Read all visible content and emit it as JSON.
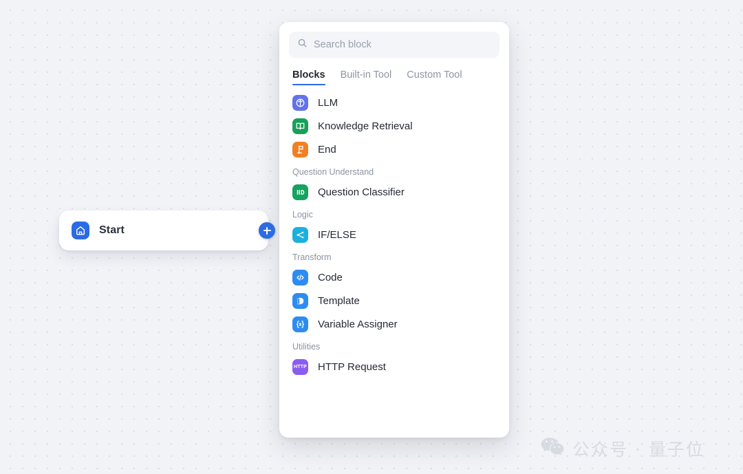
{
  "canvas": {
    "start_node": {
      "icon": "home-icon",
      "label": "Start",
      "add_handle": "plus-icon",
      "accent_color": "#2b6be4"
    }
  },
  "panel": {
    "search": {
      "icon": "search-icon",
      "value": "",
      "placeholder": "Search block"
    },
    "tabs": [
      {
        "label": "Blocks",
        "active": true
      },
      {
        "label": "Built-in Tool",
        "active": false
      },
      {
        "label": "Custom Tool",
        "active": false
      }
    ],
    "active_tab_color": "#2b6be4",
    "groups": [
      {
        "label": "",
        "items": [
          {
            "label": "LLM",
            "icon": "llm-icon",
            "color": "#6472ea"
          },
          {
            "label": "Knowledge Retrieval",
            "icon": "book-icon",
            "color": "#18a058"
          },
          {
            "label": "End",
            "icon": "flag-icon",
            "color": "#f08023"
          }
        ]
      },
      {
        "label": "Question Understand",
        "items": [
          {
            "label": "Question Classifier",
            "icon": "classifier-icon",
            "color": "#16a35f"
          }
        ]
      },
      {
        "label": "Logic",
        "items": [
          {
            "label": "IF/ELSE",
            "icon": "branch-icon",
            "color": "#1cb0dd"
          }
        ]
      },
      {
        "label": "Transform",
        "items": [
          {
            "label": "Code",
            "icon": "code-icon",
            "color": "#2e8cf0"
          },
          {
            "label": "Template",
            "icon": "template-icon",
            "color": "#2e8cf0"
          },
          {
            "label": "Variable Assigner",
            "icon": "variable-icon",
            "color": "#2e8cf0"
          }
        ]
      },
      {
        "label": "Utilities",
        "items": [
          {
            "label": "HTTP Request",
            "icon": "http-icon",
            "color": "#8a5cf0",
            "badge_text": "HTTP"
          }
        ]
      }
    ]
  },
  "watermark": {
    "icon": "wechat-icon",
    "text": "公众号 · 量子位"
  }
}
